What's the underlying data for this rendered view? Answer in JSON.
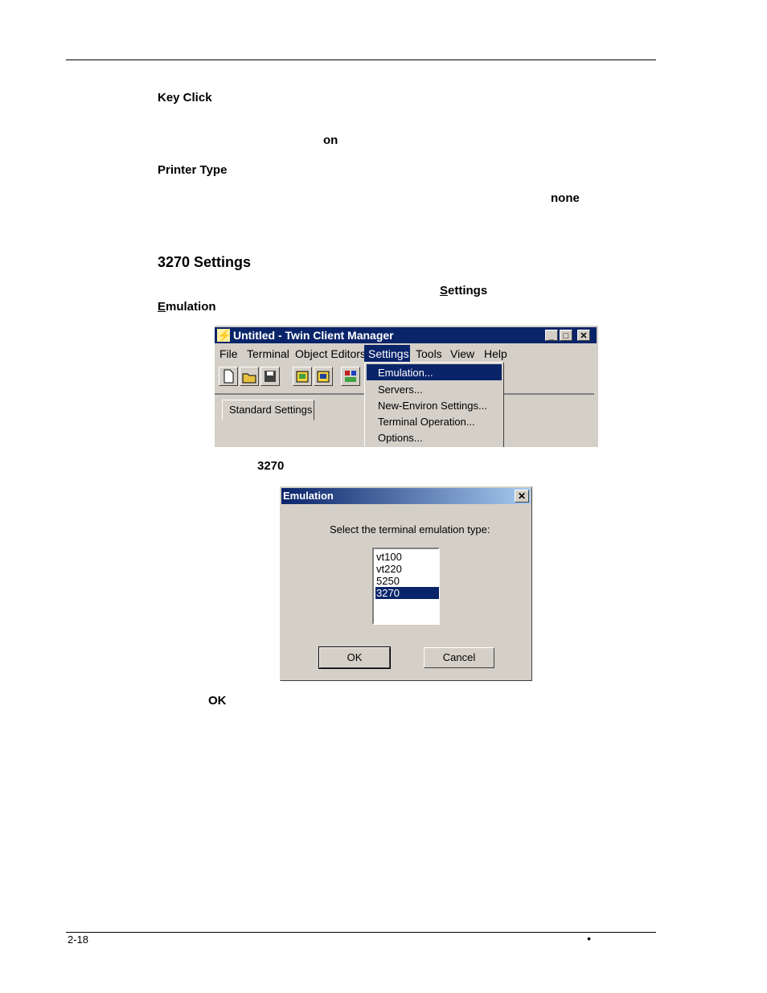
{
  "doc": {
    "key_click_heading": "Key Click",
    "key_click_value": "on",
    "printer_type_heading": "Printer Type",
    "printer_type_value": "none",
    "section_heading": "3270 Settings",
    "menu_ref_settings": "Settings",
    "menu_ref_emulation": "Emulation",
    "select_value": "3270",
    "ok_ref": "OK",
    "page_number": "2-18",
    "footer_bullet": "•"
  },
  "tcm_window": {
    "title": "Untitled - Twin Client Manager",
    "caption_buttons": [
      "_",
      "□",
      "✕"
    ],
    "menus": [
      "File",
      "Terminal",
      "Object Editors",
      "Settings",
      "Tools",
      "View",
      "Help"
    ],
    "selected_menu": "Settings",
    "tab_label": "Standard Settings",
    "dropdown_items": [
      "Emulation...",
      "Servers...",
      "New-Environ Settings...",
      "Terminal Operation...",
      "Options..."
    ],
    "selected_dropdown_item": "Emulation..."
  },
  "emulation_dialog": {
    "title": "Emulation",
    "close_glyph": "✕",
    "prompt": "Select the terminal emulation type:",
    "options": [
      "vt100",
      "vt220",
      "5250",
      "3270"
    ],
    "selected_option": "3270",
    "ok_label": "OK",
    "cancel_label": "Cancel"
  },
  "colors": {
    "titlebar": "#0a246a",
    "dialog_face": "#d4d0c8",
    "selection": "#0a246a"
  }
}
